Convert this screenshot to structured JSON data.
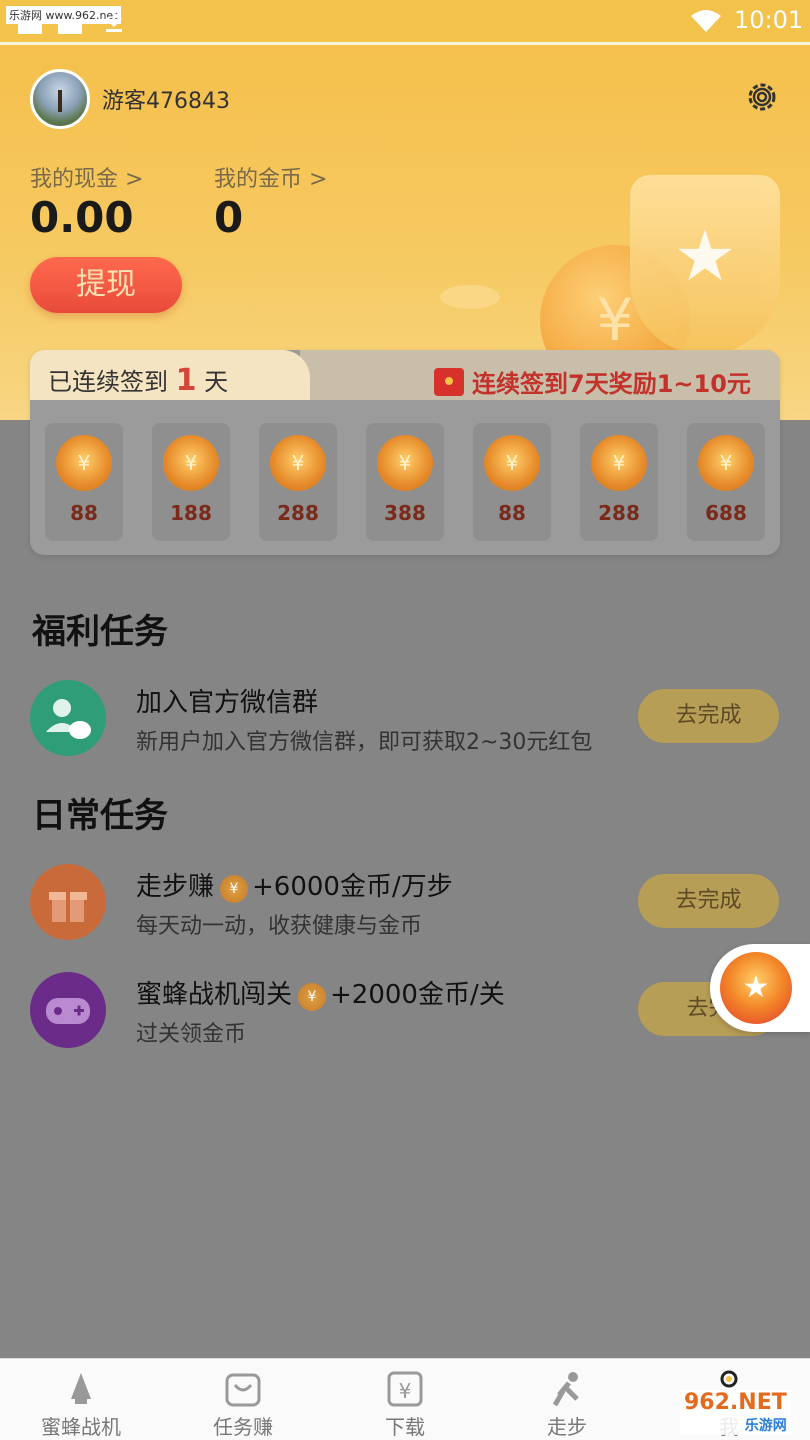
{
  "status_bar": {
    "watermark": "乐游网 www.962.net",
    "time": "10:01"
  },
  "header": {
    "username": "游客476843",
    "cash_label": "我的现金 >",
    "cash_value": "0.00",
    "coin_label": "我的金币 >",
    "coin_value": "0",
    "withdraw_label": "提现",
    "deco_symbol": "¥"
  },
  "signin": {
    "prefix": "已连续签到",
    "days": "1",
    "suffix": "天",
    "reward_title": "连续签到7天奖励1~10元",
    "coin_symbol": "¥",
    "days_list": [
      "88",
      "188",
      "288",
      "388",
      "88",
      "288",
      "688"
    ]
  },
  "welfare": {
    "title": "福利任务",
    "task": {
      "title": "加入官方微信群",
      "desc": "新用户加入官方微信群，即可获取2~30元红包",
      "button": "去完成"
    }
  },
  "daily": {
    "title": "日常任务",
    "tasks": [
      {
        "title": "走步赚",
        "reward": "+6000金币/万步",
        "desc": "每天动一动，收获健康与金币",
        "button": "去完成"
      },
      {
        "title": "蜜蜂战机闯关",
        "reward": "+2000金币/关",
        "desc": "过关领金币",
        "button": "去完"
      }
    ]
  },
  "bottom_nav": {
    "items": [
      "蜜蜂战机",
      "任务赚",
      "下载",
      "走步",
      "我"
    ]
  },
  "watermark_962": {
    "main": "962.NET",
    "sub": "乐游网"
  },
  "colors": {
    "primary": "#f5c04c",
    "accent_red": "#e84a3a",
    "overlay": "#858585"
  }
}
